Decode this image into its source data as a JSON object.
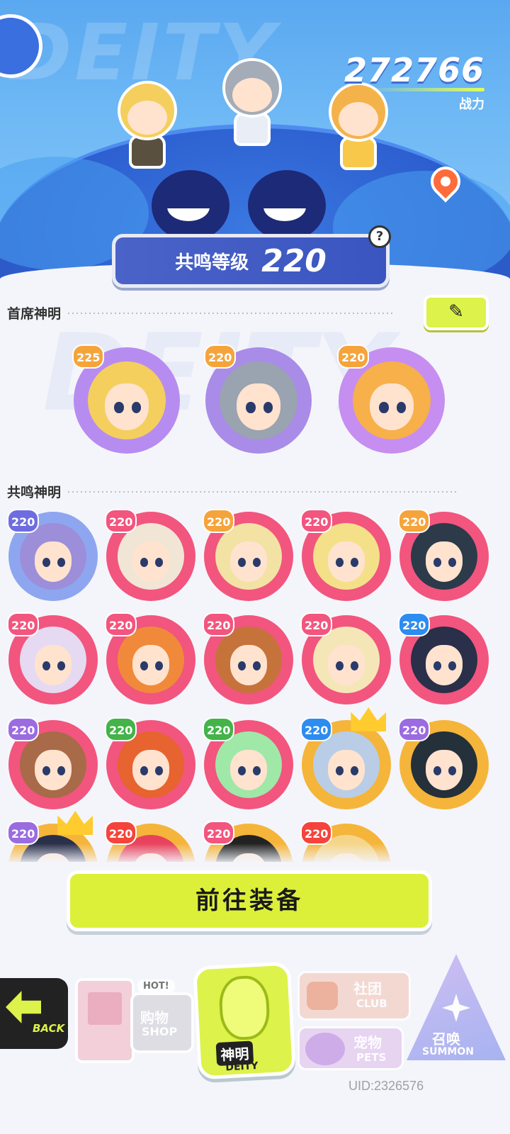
{
  "header": {
    "power_value": "272766",
    "power_label": "战力",
    "resonance_title": "共鸣等级",
    "resonance_level": "220",
    "help_symbol": "?",
    "bg_word": "DEITY"
  },
  "sections": {
    "chief_label": "首席神明",
    "resonance_label": "共鸣神明",
    "edit_symbol": "✎"
  },
  "chief_deities": [
    {
      "level": "225",
      "ring": "#b78cf0",
      "hair": "#f4cf5e"
    },
    {
      "level": "220",
      "ring": "#a98be8",
      "hair": "#9aa3b0"
    },
    {
      "level": "220",
      "ring": "#c68ef0",
      "hair": "#f7b04a"
    }
  ],
  "resonance_deities": [
    {
      "level": "220",
      "ring": "#8ea6f0",
      "hair": "#9c8ed8",
      "badge": "#6e6de0"
    },
    {
      "level": "220",
      "ring": "#f2557e",
      "hair": "#f1e6d6",
      "badge": "#f2557e"
    },
    {
      "level": "220",
      "ring": "#f2557e",
      "hair": "#f2e3a4",
      "badge": "#f5a43b"
    },
    {
      "level": "220",
      "ring": "#f2557e",
      "hair": "#f5e08a",
      "badge": "#f2557e"
    },
    {
      "level": "220",
      "ring": "#f2557e",
      "hair": "#2c3a4a",
      "badge": "#f5a43b"
    },
    {
      "level": "220",
      "ring": "#f2557e",
      "hair": "#e6d9f2",
      "badge": "#f2557e"
    },
    {
      "level": "220",
      "ring": "#f2557e",
      "hair": "#f08a3a",
      "badge": "#f2557e"
    },
    {
      "level": "220",
      "ring": "#f2557e",
      "hair": "#c5733a",
      "badge": "#f2557e"
    },
    {
      "level": "220",
      "ring": "#f2557e",
      "hair": "#f5e6b8",
      "badge": "#f2557e"
    },
    {
      "level": "220",
      "ring": "#f2557e",
      "hair": "#2a2f4a",
      "badge": "#2d8cf0"
    },
    {
      "level": "220",
      "ring": "#f2557e",
      "hair": "#a86a48",
      "badge": "#9b6be0"
    },
    {
      "level": "220",
      "ring": "#f2557e",
      "hair": "#e7632f",
      "badge": "#43b34a"
    },
    {
      "level": "220",
      "ring": "#f2557e",
      "hair": "#9fe8a8",
      "badge": "#43b34a"
    },
    {
      "level": "220",
      "ring": "#f5b53a",
      "hair": "#b9cde6",
      "badge": "#2d8cf0",
      "crown": true
    },
    {
      "level": "220",
      "ring": "#f5b53a",
      "hair": "#24303a",
      "badge": "#9b6be0"
    },
    {
      "level": "220",
      "ring": "#f5b53a",
      "hair": "#2a2f4a",
      "badge": "#9b6be0",
      "crown": true
    },
    {
      "level": "220",
      "ring": "#f5b53a",
      "hair": "#e8425c",
      "badge": "#f5443b"
    },
    {
      "level": "220",
      "ring": "#f5b53a",
      "hair": "#222",
      "badge": "#f2557e"
    },
    {
      "level": "220",
      "ring": "#f5b53a",
      "hair": "#f5d58a",
      "badge": "#f5443b"
    }
  ],
  "actions": {
    "goto_equip": "前往装备"
  },
  "nav": {
    "back": "BACK",
    "shop_cn": "购物",
    "shop_en": "SHOP",
    "shop_hot": "HOT!",
    "deity_cn": "神明",
    "deity_en": "DEITY",
    "club_cn": "社团",
    "club_en": "CLUB",
    "pets_cn": "宠物",
    "pets_en": "PETS",
    "summon_cn": "召唤",
    "summon_en": "SUMMON"
  },
  "footer": {
    "uid": "UID:2326576"
  }
}
